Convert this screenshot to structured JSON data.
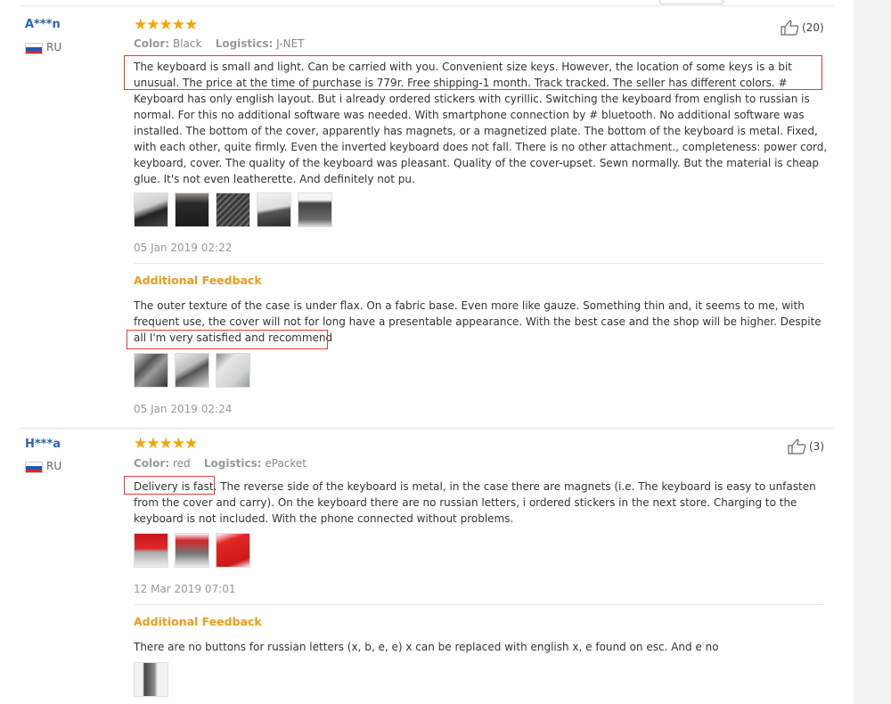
{
  "reviews": [
    {
      "user": "A***n",
      "country": "RU",
      "stars": "★★★★★",
      "helpful_count": "(20)",
      "color_label": "Color:",
      "color_value": "Black",
      "logistics_label": "Logistics:",
      "logistics_value": "J-NET",
      "text": "The keyboard is small and light. Can be carried with you. Convenient size keys. However, the location of some keys is a bit unusual. The price at the time of purchase is 779r. Free shipping-1 month. Track tracked. The seller has different colors. # Keyboard has only english layout. But i already ordered stickers with cyrillic. Switching the keyboard from english to russian is normal. For this no additional software was needed. With smartphone connection by # bluetooth. No additional software was installed. The bottom of the cover, apparently has magnets, or a magnetized plate. The bottom of the keyboard is metal. Fixed, with each other, quite firmly. Even the inverted keyboard does not fall. There is no other attachment., completeness: power cord, keyboard, cover. The quality of the keyboard was pleasant. Quality of the cover-upset. Sewn normally. But the material is cheap glue. It's not even leatherette. And definitely not pu.",
      "date": "05 Jan 2019 02:22",
      "additional_title": "Additional Feedback",
      "additional_text": "The outer texture of the case is under flax. On a fabric base. Even more like gauze. Something thin and, it seems to me, with frequent use, the cover will not for long have a presentable appearance. With the best case and the shop will be higher. Despite all I'm very satisfied and recommend",
      "additional_date": "05 Jan 2019 02:24"
    },
    {
      "user": "H***a",
      "country": "RU",
      "stars": "★★★★★",
      "helpful_count": "(3)",
      "color_label": "Color:",
      "color_value": "red",
      "logistics_label": "Logistics:",
      "logistics_value": "ePacket",
      "text": "Delivery is fast. The reverse side of the keyboard is metal, in the case there are magnets (i.e. The keyboard is easy to unfasten from the cover and carry). On the keyboard there are no russian letters, i ordered stickers in the next store. Charging to the keyboard is not included. With the phone connected without problems.",
      "date": "12 Mar 2019 07:01",
      "additional_title": "Additional Feedback",
      "additional_text": "There are no buttons for russian letters (x, b, e, e) x can be replaced with english x, e found on esc. And e no"
    }
  ],
  "colors": {
    "username": "#2a64b4",
    "stars": "#f6a500",
    "additional_title": "#f09a1a",
    "highlight_box": "#e03a3a"
  },
  "icons": {
    "helpful": "thumbs-up-icon",
    "flag": "russia-flag-icon"
  }
}
